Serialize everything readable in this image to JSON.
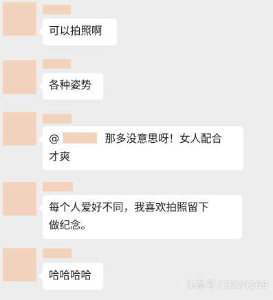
{
  "messages": [
    {
      "text": "可以拍照啊"
    },
    {
      "text": "各种姿势"
    },
    {
      "mention": "@",
      "text_line1": "那多没意思呀！女人配合",
      "text_line2": "才爽"
    },
    {
      "text_line1": "每个人爱好不同，我喜欢拍照留下",
      "text_line2": "做纪念。"
    },
    {
      "text": "哈哈哈哈"
    }
  ],
  "watermark": "头条号 / 8224168",
  "colors": {
    "background": "#ededed",
    "bubble": "#ffffff",
    "redaction": "#f1d3be",
    "text": "#1a1a1a"
  }
}
